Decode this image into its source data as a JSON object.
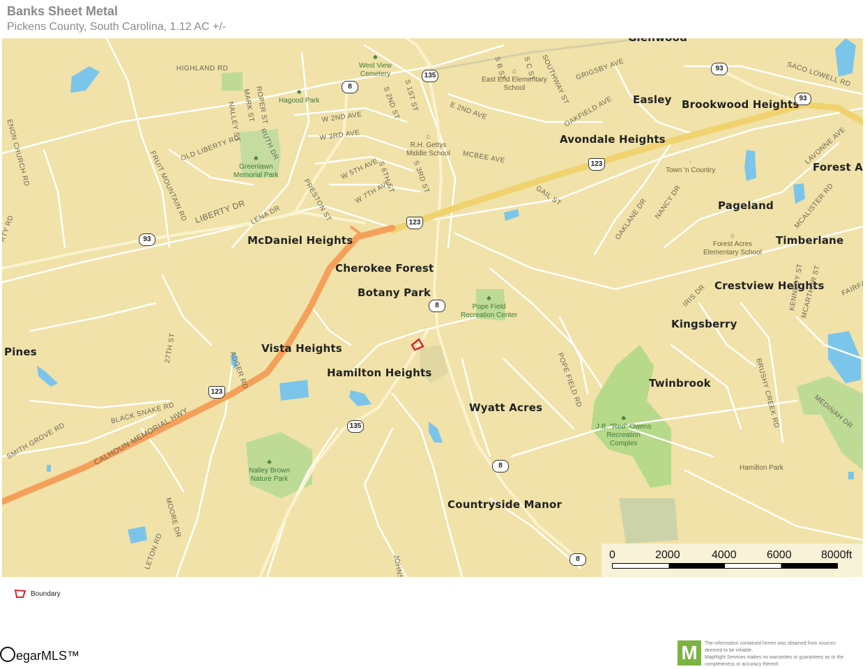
{
  "header": {
    "title": "Banks Sheet Metal",
    "subtitle": "Pickens County, South Carolina, 1.12 AC +/-"
  },
  "map": {
    "places": [
      {
        "id": "glenwood",
        "text": "Glenwood"
      },
      {
        "id": "easley",
        "text": "Easley"
      },
      {
        "id": "brookwood-heights",
        "text": "Brookwood Heights"
      },
      {
        "id": "avondale-heights",
        "text": "Avondale Heights"
      },
      {
        "id": "forest-ac",
        "text": "Forest Ac"
      },
      {
        "id": "pageland",
        "text": "Pageland"
      },
      {
        "id": "timberlane",
        "text": "Timberlane"
      },
      {
        "id": "mcdaniel-heights",
        "text": "McDaniel Heights"
      },
      {
        "id": "cherokee-forest",
        "text": "Cherokee Forest"
      },
      {
        "id": "botany-park",
        "text": "Botany Park"
      },
      {
        "id": "crestview-heights",
        "text": "Crestview Heights"
      },
      {
        "id": "kingsberry",
        "text": "Kingsberry"
      },
      {
        "id": "pines",
        "text": "Pines"
      },
      {
        "id": "vista-heights",
        "text": "Vista Heights"
      },
      {
        "id": "hamilton-heights",
        "text": "Hamilton Heights"
      },
      {
        "id": "twinbrook",
        "text": "Twinbrook"
      },
      {
        "id": "wyatt-acres",
        "text": "Wyatt Acres"
      },
      {
        "id": "countryside-manor",
        "text": "Countryside Manor"
      }
    ],
    "pois": [
      {
        "id": "west-view-cemetery",
        "line1": "West View",
        "line2": "Cemetery",
        "kind": "park"
      },
      {
        "id": "hagood-park",
        "line1": "Hagood Park",
        "line2": "",
        "kind": "park"
      },
      {
        "id": "greenlawn",
        "line1": "Greenlawn",
        "line2": "Memorial Park",
        "kind": "park"
      },
      {
        "id": "east-end-school",
        "line1": "East End Elementary",
        "line2": "School",
        "kind": "school"
      },
      {
        "id": "rh-gettys",
        "line1": "R.H. Gettys",
        "line2": "Middle School",
        "kind": "school"
      },
      {
        "id": "town-n-country",
        "line1": "Town 'n Country",
        "line2": "",
        "kind": "school"
      },
      {
        "id": "forest-acres-school",
        "line1": "Forest Acres",
        "line2": "Elementary School",
        "kind": "school"
      },
      {
        "id": "pope-field",
        "line1": "Pope Field",
        "line2": "Recreation Center",
        "kind": "park"
      },
      {
        "id": "jb-owens",
        "line1": "J.B. \"Red\" Owens",
        "line2": "Recreation",
        "line3": "Complex",
        "kind": "park"
      },
      {
        "id": "nalley-brown",
        "line1": "Nalley Brown",
        "line2": "Nature Park",
        "kind": "park"
      },
      {
        "id": "hamilton-park",
        "line1": "Hamilton Park",
        "line2": "",
        "kind": "school"
      }
    ],
    "streets": [
      "HIGHLAND RD",
      "NALLEY ST",
      "MARK ST",
      "ROPER ST",
      "RUTH DR",
      "ENON CHURCH RD",
      "FRUIT MOUNTAIN RD",
      "OLD LIBERTY RD",
      "W 2ND AVE",
      "W 3RD AVE",
      "W 5TH AVE",
      "W 7TH AVE",
      "S 6TH ST",
      "S 3RD ST",
      "S 2ND ST",
      "S 1ST ST",
      "S B ST",
      "S C ST",
      "SOUTHWAY ST",
      "GRIGSBY AVE",
      "SACO LOWELL RD",
      "E 2ND AVE",
      "MCBEE AVE",
      "OAKFIELD AVE",
      "LAVONNE AVE",
      "GAIL ST",
      "OAKLANE DR",
      "NANCY DR",
      "MCALISTER RD",
      "LIBERTY DR",
      "LENA DR",
      "PRESTON ST",
      "IRIS DR",
      "FAIRFA",
      "KENNEDY ST",
      "MCARTHUR ST",
      "BRUSHY CREEK RD",
      "MEDINAH DR",
      "POPE FIELD RD",
      "ADGER RD",
      "27TH ST",
      "BLACK SNAKE RD",
      "SMITH GROVE RD",
      "CALHOUN MEMORIAL HWY",
      "MOORE DR",
      "LETON RD",
      "JOHNSO",
      "RTY RD"
    ],
    "shields": {
      "sc135": "135",
      "sc8": "8",
      "sc93": "93",
      "us123": "123"
    },
    "scale": {
      "labels": [
        "0",
        "2000",
        "4000",
        "6000",
        "8000ft"
      ]
    },
    "colors": {
      "land": "#f0e2a8",
      "park": "#b7d98a",
      "water": "#7cc5ea",
      "highway": "#f5a05a",
      "arterial": "#f0d36e",
      "boundary": "#d9262b"
    }
  },
  "legend": {
    "boundary_label": "Boundary"
  },
  "footer": {
    "logo_text": "egarMLS™",
    "badge_letter": "M",
    "disclaimer_line1": "The information contained herein was obtained from sources",
    "disclaimer_line2": "deemed to be reliable.",
    "disclaimer_line3": "MapRight Services makes no warranties or guarantees as to the",
    "disclaimer_line4": "completeness or accuracy thereof."
  }
}
